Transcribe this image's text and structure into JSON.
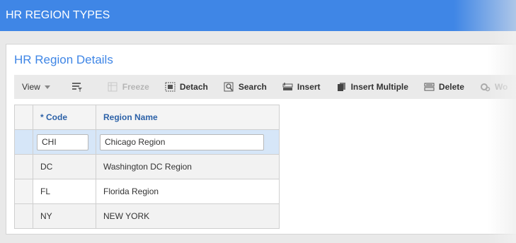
{
  "app": {
    "title": "HR REGION TYPES"
  },
  "panel": {
    "title": "HR Region Details"
  },
  "toolbar": {
    "view": "View",
    "filter_icon": "filter-icon",
    "freeze": "Freeze",
    "detach": "Detach",
    "search": "Search",
    "insert": "Insert",
    "insert_multiple": "Insert Multiple",
    "delete": "Delete",
    "more_partial": "Wo"
  },
  "table": {
    "columns": {
      "code": "* Code",
      "region_name": "Region Name"
    },
    "rows": [
      {
        "code": "CHI",
        "region_name": "Chicago Region",
        "editing": true
      },
      {
        "code": "DC",
        "region_name": "Washington DC Region"
      },
      {
        "code": "FL",
        "region_name": "Florida Region"
      },
      {
        "code": "NY",
        "region_name": "NEW YORK"
      }
    ]
  },
  "colors": {
    "header_bar": "#3f86e6",
    "accent_text": "#3f86e6",
    "column_header": "#2d62a8",
    "active_row": "#d6e6f8"
  }
}
